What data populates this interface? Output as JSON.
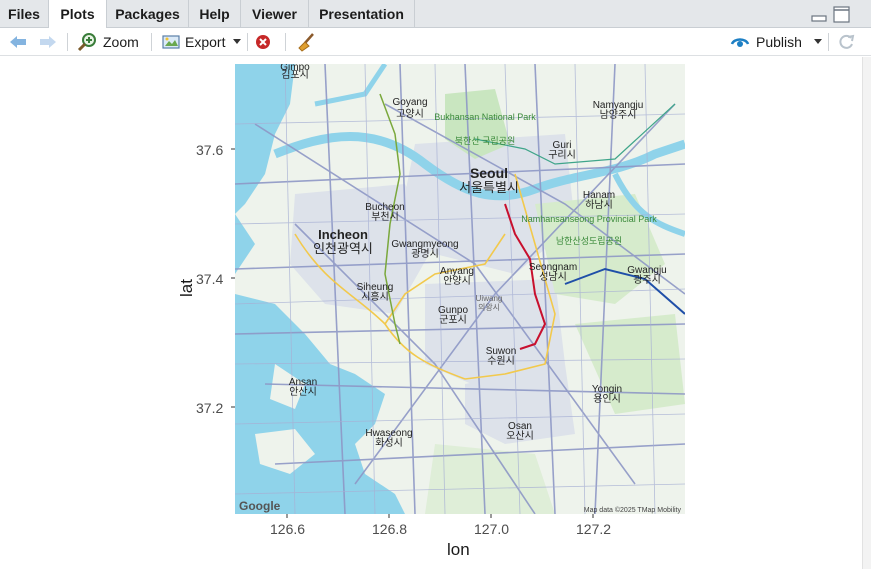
{
  "tabs": [
    {
      "label": "Files",
      "active": false
    },
    {
      "label": "Plots",
      "active": true
    },
    {
      "label": "Packages",
      "active": false
    },
    {
      "label": "Help",
      "active": false
    },
    {
      "label": "Viewer",
      "active": false
    },
    {
      "label": "Presentation",
      "active": false
    }
  ],
  "toolbar": {
    "zoom_label": "Zoom",
    "export_label": "Export",
    "publish_label": "Publish",
    "icons": [
      "back-arrow-icon",
      "forward-arrow-icon",
      "zoom-icon",
      "export-icon",
      "remove-plot-icon",
      "broom-icon",
      "publish-icon",
      "refresh-icon"
    ]
  },
  "plot": {
    "xlabel": "lon",
    "ylabel": "lat",
    "x_ticks": [
      "126.6",
      "126.8",
      "127.0",
      "127.2"
    ],
    "y_ticks": [
      "37.6",
      "37.4",
      "37.2"
    ],
    "attribution_left": "Google",
    "attribution_right": "Map data ©2025 TMap Mobility",
    "places": [
      {
        "en": "Gimpo",
        "ko": "김포시"
      },
      {
        "en": "Goyang",
        "ko": "고양시"
      },
      {
        "en": "Bukhansan National Park",
        "ko": "북한산 국립공원"
      },
      {
        "en": "Namyangju",
        "ko": "남양주시"
      },
      {
        "en": "Guri",
        "ko": "구리시"
      },
      {
        "en": "Seoul",
        "ko": "서울특별시"
      },
      {
        "en": "Hanam",
        "ko": "하남시"
      },
      {
        "en": "Bucheon",
        "ko": "부천시"
      },
      {
        "en": "Namhansanseong Provincial Park",
        "ko": "남한산성도립공원"
      },
      {
        "en": "Incheon",
        "ko": "인천광역시"
      },
      {
        "en": "Gwangmyeong",
        "ko": "광명시"
      },
      {
        "en": "Anyang",
        "ko": "안양시"
      },
      {
        "en": "Seongnam",
        "ko": "성남시"
      },
      {
        "en": "Gwangju",
        "ko": "광주시"
      },
      {
        "en": "Siheung",
        "ko": "시흥시"
      },
      {
        "en": "Uiwang",
        "ko": "의왕시"
      },
      {
        "en": "Gunpo",
        "ko": "군포시"
      },
      {
        "en": "Suwon",
        "ko": "수원시"
      },
      {
        "en": "Ansan",
        "ko": "안산시"
      },
      {
        "en": "Yongin",
        "ko": "용인시"
      },
      {
        "en": "Hwaseong",
        "ko": "화성시"
      },
      {
        "en": "Osan",
        "ko": "오산시"
      }
    ]
  },
  "colors": {
    "water": "#8fd3ea",
    "land": "#eef3ec",
    "park": "#c9e6c0",
    "urban": "#dde2ea",
    "road": "#8e98c6",
    "highway_yellow": "#f2c94c",
    "line_red": "#c8102e",
    "line_blue": "#1f4fa8"
  }
}
